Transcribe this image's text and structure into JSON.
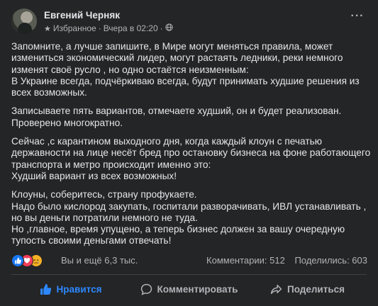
{
  "post": {
    "author": "Евгений Черняк",
    "audience": "Избранное",
    "time": "Вчера в 02:20",
    "separator": "·",
    "more_label": "···",
    "paragraphs": [
      [
        "Запомните, а лучше запишите, в Мире могут меняться правила, может",
        "измениться экономический лидер, могут растаять ледники, реки немного",
        "изменят своё русло , но одно остаётся неизменным:",
        "В Украине всегда, подчёркиваю всегда,  будут принимать худшие решения из",
        "всех возможных."
      ],
      [
        "Записываете пять вариантов, отмечаете худший, он и будет реализован.",
        "Проверено многократно."
      ],
      [
        "Сейчас ,с карантином выходного дня, когда каждый клоун с печатью",
        "державности на лице несёт бред про остановку бизнеса на фоне работающего",
        "транспорта и метро происходит именно это:",
        "Худший вариант из всех возможных!"
      ],
      [
        "Клоуны, соберитесь, страну профукаете.",
        "Надо было кислород закупать, госпитали разворачивать, ИВЛ устанавливать ,",
        "но вы деньги потратили немного не туда.",
        "Но ,главное, время упущено, а теперь бизнес должен за вашу очередную",
        "тупость своими деньгами отвечать!"
      ]
    ]
  },
  "reactions": {
    "text": "Вы и ещё 6,3 тыс.",
    "icons": [
      "like-icon",
      "love-icon",
      "sad-icon"
    ],
    "comments": "Комментарии: 512",
    "shares": "Поделились: 603"
  },
  "actions": {
    "like": "Нравится",
    "comment": "Комментировать",
    "share": "Поделиться"
  },
  "colors": {
    "background": "#242526",
    "text": "#e4e6eb",
    "secondary": "#b0b3b8",
    "accent": "#2d88ff",
    "divider": "#3e4042"
  }
}
